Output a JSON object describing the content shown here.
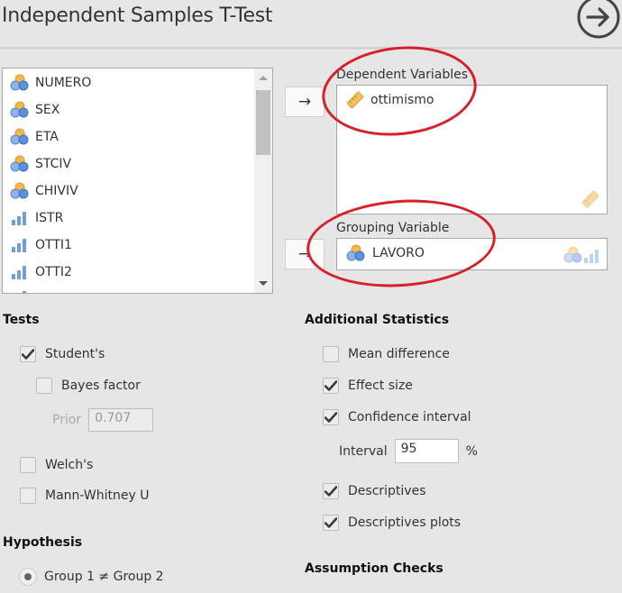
{
  "header": {
    "title": "Independent Samples T-Test",
    "run_icon": "arrow-circle-right-icon"
  },
  "variables_list": {
    "items": [
      {
        "label": "NUMERO",
        "type": "nominal"
      },
      {
        "label": "SEX",
        "type": "nominal"
      },
      {
        "label": "ETA",
        "type": "nominal"
      },
      {
        "label": "STCIV",
        "type": "nominal"
      },
      {
        "label": "CHIVIV",
        "type": "nominal"
      },
      {
        "label": "ISTR",
        "type": "ordinal"
      },
      {
        "label": "OTTI1",
        "type": "ordinal"
      },
      {
        "label": "OTTI2",
        "type": "ordinal"
      }
    ]
  },
  "assign": {
    "arrow": "→"
  },
  "dependent": {
    "label": "Dependent Variables",
    "items": [
      {
        "label": "ottimismo",
        "type": "scale"
      }
    ],
    "allowed_icon": "scale-ruler-icon"
  },
  "grouping": {
    "label": "Grouping Variable",
    "value": {
      "label": "LAVORO",
      "type": "nominal"
    },
    "allowed_icons": [
      "nominal-icon",
      "ordinal-icon"
    ]
  },
  "tests": {
    "heading": "Tests",
    "students": {
      "label": "Student's",
      "checked": true
    },
    "bayes": {
      "label": "Bayes factor",
      "checked": false
    },
    "prior": {
      "label": "Prior",
      "value": "0.707"
    },
    "welch": {
      "label": "Welch's",
      "checked": false
    },
    "mann_whitney": {
      "label": "Mann-Whitney U",
      "checked": false
    }
  },
  "hypothesis": {
    "heading": "Hypothesis",
    "options": [
      {
        "label": "Group 1 ≠ Group 2",
        "selected": true
      }
    ]
  },
  "additional": {
    "heading": "Additional Statistics",
    "mean_difference": {
      "label": "Mean difference",
      "checked": false
    },
    "effect_size": {
      "label": "Effect size",
      "checked": true
    },
    "confidence_interval": {
      "label": "Confidence interval",
      "checked": true
    },
    "interval": {
      "label": "Interval",
      "value": "95",
      "unit": "%"
    },
    "descriptives": {
      "label": "Descriptives",
      "checked": true
    },
    "descriptives_plots": {
      "label": "Descriptives plots",
      "checked": true
    }
  },
  "assumption": {
    "heading": "Assumption Checks"
  },
  "annotation": {
    "color": "#d6202a"
  }
}
